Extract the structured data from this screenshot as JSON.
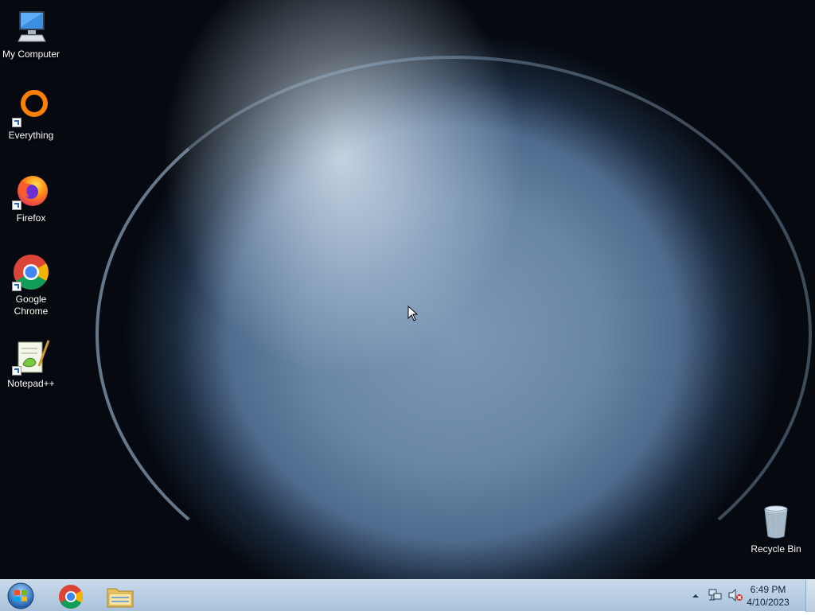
{
  "desktop": {
    "icons": [
      {
        "label": "My Computer",
        "icon": "computer-icon"
      },
      {
        "label": "Everything",
        "icon": "everything-icon"
      },
      {
        "label": "Firefox",
        "icon": "firefox-icon"
      },
      {
        "label": "Google Chrome",
        "icon": "chrome-icon"
      },
      {
        "label": "Notepad++",
        "icon": "notepadpp-icon"
      }
    ],
    "recycle_bin": {
      "label": "Recycle Bin",
      "icon": "recycle-bin-icon"
    }
  },
  "taskbar": {
    "start_icon": "windows-start-icon",
    "pinned": [
      {
        "name": "Google Chrome",
        "icon": "chrome-icon"
      },
      {
        "name": "File Explorer",
        "icon": "folder-icon"
      }
    ],
    "tray": {
      "icons": [
        "show-hidden-icons-icon",
        "network-icon",
        "volume-muted-icon"
      ]
    },
    "clock": {
      "time": "6:49 PM",
      "date": "4/10/2023"
    }
  },
  "colors": {
    "taskbar_top": "#c9daea",
    "taskbar_bottom": "#a9c2db",
    "chrome_red": "#db4437",
    "chrome_green": "#0f9d58",
    "chrome_yellow": "#f4b400",
    "chrome_blue": "#4285f4"
  }
}
